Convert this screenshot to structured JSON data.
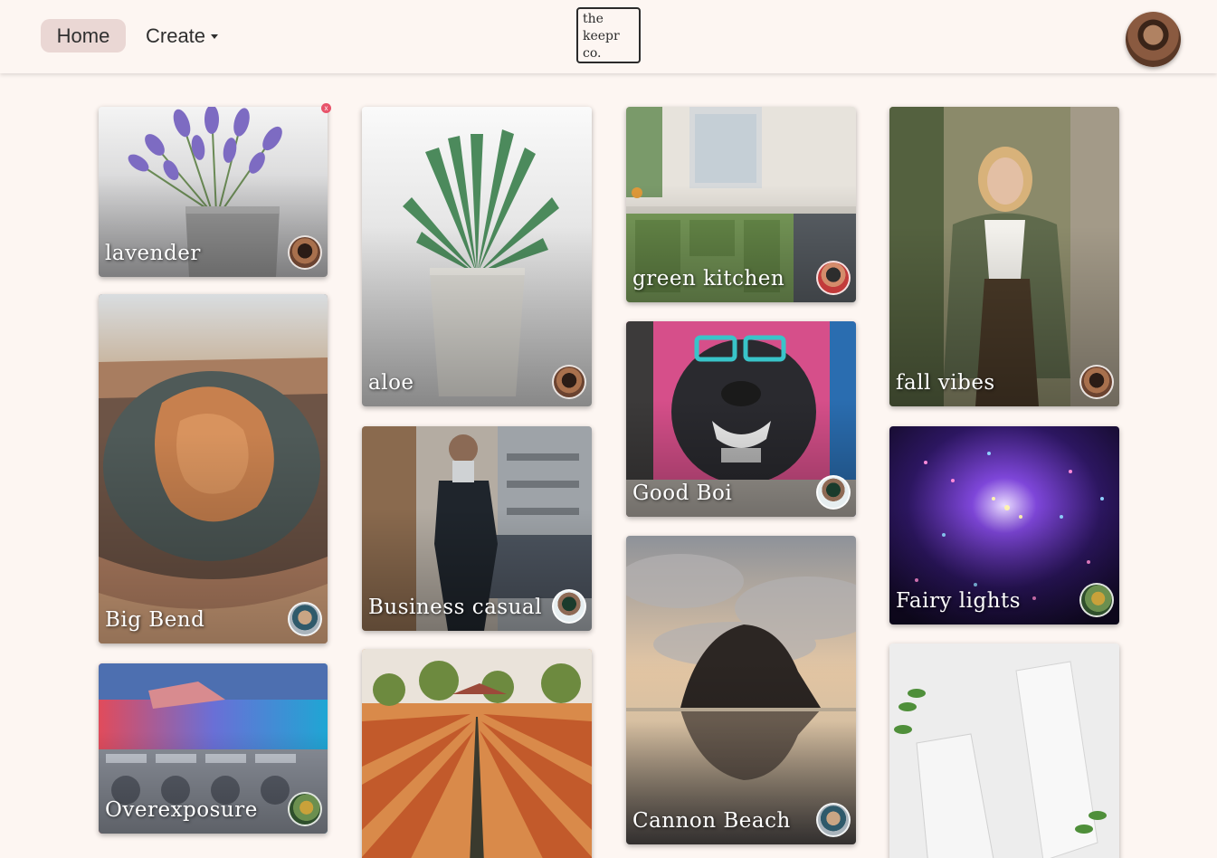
{
  "nav": {
    "home_label": "Home",
    "create_label": "Create",
    "logo_lines": [
      "the",
      "keepr",
      "co."
    ]
  },
  "cards": [
    {
      "title": "lavender",
      "image": "lavender plant in grey pot",
      "creator_avatar": "user-avatar-icon"
    },
    {
      "title": "Big Bend",
      "image": "horseshoe canyon river bend",
      "creator_avatar": "user-avatar-icon"
    },
    {
      "title": "Overexposure",
      "image": "neon laundromat",
      "creator_avatar": "user-avatar-icon"
    },
    {
      "title": "aloe",
      "image": "aloe plant in white pot",
      "creator_avatar": "user-avatar-icon"
    },
    {
      "title": "Business casual",
      "image": "man in suit",
      "creator_avatar": "user-avatar-icon"
    },
    {
      "title": "",
      "image": "tulip field",
      "creator_avatar": ""
    },
    {
      "title": "green kitchen",
      "image": "green kitchen cabinets",
      "creator_avatar": "user-avatar-icon"
    },
    {
      "title": "Good Boi",
      "image": "dog graffiti mural",
      "creator_avatar": "user-avatar-icon"
    },
    {
      "title": "Cannon Beach",
      "image": "haystack rock at sunset",
      "creator_avatar": "user-avatar-icon"
    },
    {
      "title": "fall vibes",
      "image": "woman in tweed blazer",
      "creator_avatar": "user-avatar-icon"
    },
    {
      "title": "Fairy lights",
      "image": "string light tunnel",
      "creator_avatar": "user-avatar-icon"
    },
    {
      "title": "",
      "image": "boxed water cartons",
      "creator_avatar": ""
    }
  ],
  "delete_icon": "x",
  "colors": {
    "background": "#fdf6f2",
    "home_pill": "#ead7d4",
    "delete": "#e8536a"
  }
}
